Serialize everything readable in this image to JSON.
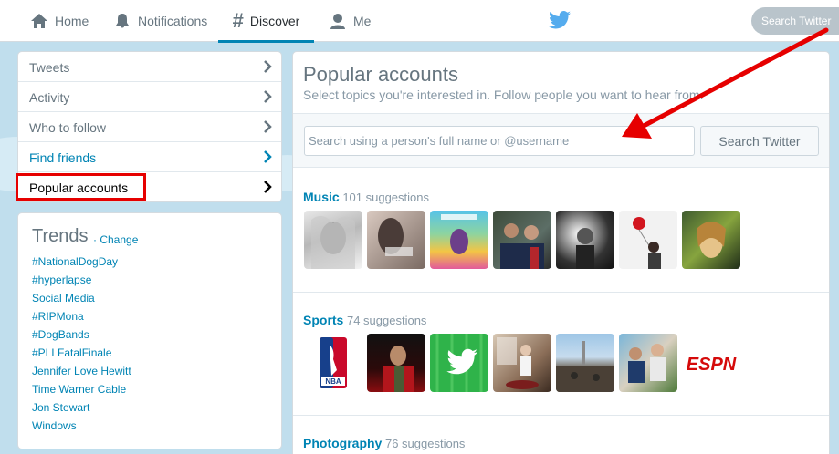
{
  "nav": {
    "items": [
      {
        "label": "Home",
        "icon": "home-icon"
      },
      {
        "label": "Notifications",
        "icon": "bell-icon"
      },
      {
        "label": "Discover",
        "icon": "hashtag-icon",
        "active": true
      },
      {
        "label": "Me",
        "icon": "user-icon"
      }
    ],
    "search_placeholder": "Search Twitter"
  },
  "menu": {
    "items": [
      {
        "label": "Tweets"
      },
      {
        "label": "Activity"
      },
      {
        "label": "Who to follow"
      },
      {
        "label": "Find friends"
      },
      {
        "label": "Popular accounts"
      }
    ]
  },
  "trends": {
    "title": "Trends",
    "change_label": "· Change",
    "items": [
      "#NationalDogDay",
      "#hyperlapse",
      "Social Media",
      "#RIPMona",
      "#DogBands",
      "#PLLFatalFinale",
      "Jennifer Love Hewitt",
      "Time Warner Cable",
      "Jon Stewart",
      "Windows"
    ]
  },
  "main": {
    "title": "Popular accounts",
    "subtitle": "Select topics you're interested in. Follow people you want to hear from.",
    "search_placeholder": "Search using a person's full name or @username",
    "search_button": "Search Twitter",
    "categories": [
      {
        "name": "Music",
        "count_text": "101 suggestions"
      },
      {
        "name": "Sports",
        "count_text": "74 suggestions"
      },
      {
        "name": "Photography",
        "count_text": "76 suggestions"
      }
    ],
    "sports_logos": {
      "nba": "NBA",
      "espn": "ESPN"
    }
  },
  "colors": {
    "accent": "#0084b4",
    "highlight": "#e60000",
    "background": "#c0deed"
  }
}
